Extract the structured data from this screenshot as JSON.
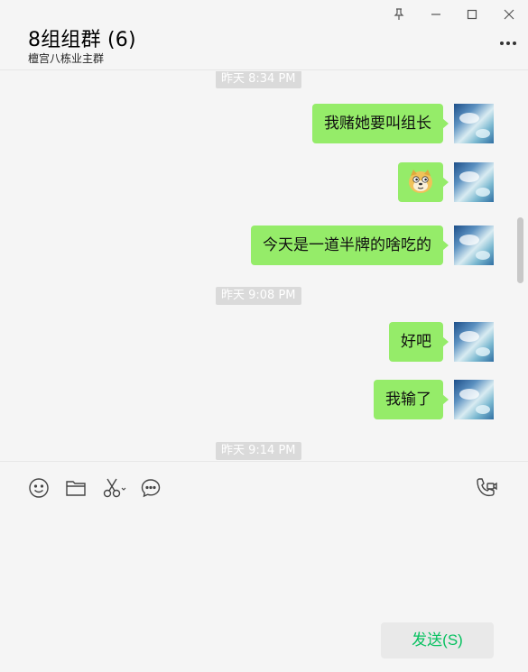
{
  "header": {
    "title": "8组组群 (6)",
    "subtitle": "檀宫八栋业主群"
  },
  "window_controls": {
    "pin": "pin-icon",
    "minimize": "minimize-icon",
    "maximize": "maximize-icon",
    "close": "close-icon"
  },
  "messages": [
    {
      "type": "timestamp",
      "text": "昨天 8:34 PM"
    },
    {
      "type": "text",
      "text": "我赌她要叫组长"
    },
    {
      "type": "emoji",
      "icon": "doge-emoji"
    },
    {
      "type": "text",
      "text": "今天是一道半牌的啥吃的"
    },
    {
      "type": "timestamp",
      "text": "昨天 9:08 PM"
    },
    {
      "type": "text",
      "text": "好吧"
    },
    {
      "type": "text",
      "text": "我输了"
    },
    {
      "type": "timestamp",
      "text": "昨天 9:14 PM"
    }
  ],
  "toolbar": {
    "emoji": "smiley-icon",
    "file": "folder-icon",
    "screenshot": "scissors-icon",
    "chat_history": "chat-bubble-icon",
    "call": "video-call-icon"
  },
  "send_button": {
    "label": "发送(S)"
  },
  "colors": {
    "bubble": "#95ec69",
    "background": "#f5f5f5",
    "send_text": "#07c160"
  }
}
